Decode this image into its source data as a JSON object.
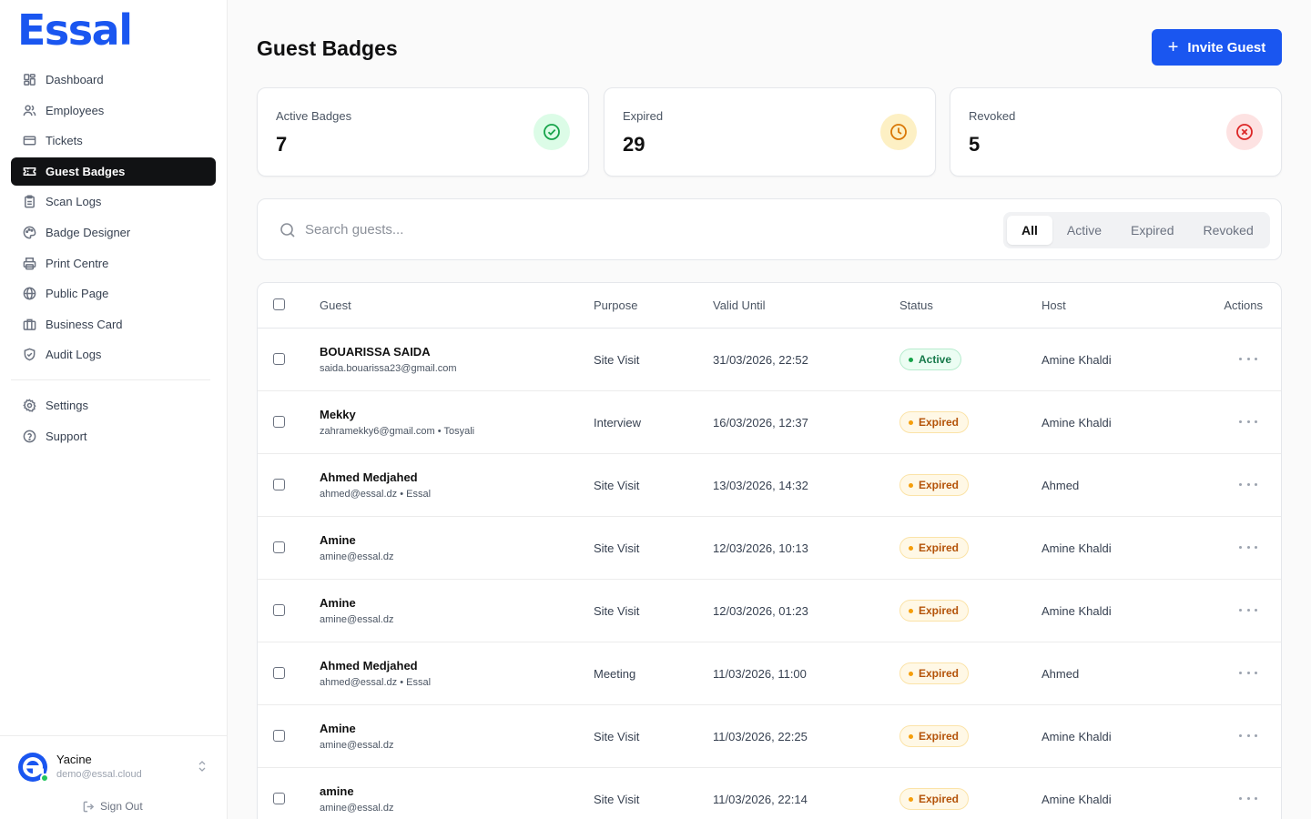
{
  "brand": {
    "name": "Essal",
    "color": "#1a56f0"
  },
  "sidebar": {
    "items": [
      {
        "label": "Dashboard",
        "icon": "dashboard-icon"
      },
      {
        "label": "Employees",
        "icon": "users-icon"
      },
      {
        "label": "Tickets",
        "icon": "ticket-icon"
      },
      {
        "label": "Guest Badges",
        "icon": "badge-icon",
        "active": true
      },
      {
        "label": "Scan Logs",
        "icon": "clipboard-icon"
      },
      {
        "label": "Badge Designer",
        "icon": "palette-icon"
      },
      {
        "label": "Print Centre",
        "icon": "printer-icon"
      },
      {
        "label": "Public Page",
        "icon": "globe-icon"
      },
      {
        "label": "Business Card",
        "icon": "briefcase-icon"
      },
      {
        "label": "Audit Logs",
        "icon": "shield-icon"
      }
    ],
    "secondary": [
      {
        "label": "Settings",
        "icon": "gear-icon"
      },
      {
        "label": "Support",
        "icon": "help-circle-icon"
      }
    ],
    "user": {
      "name": "Yacine",
      "email": "demo@essal.cloud",
      "status": "online"
    },
    "sign_out": "Sign Out"
  },
  "header": {
    "title": "Guest Badges",
    "invite_label": "Invite Guest"
  },
  "stats": [
    {
      "label": "Active Badges",
      "value": "7",
      "icon": "check-circle-icon",
      "color": "#16a34a",
      "bg": "#dcfce7"
    },
    {
      "label": "Expired",
      "value": "29",
      "icon": "clock-icon",
      "color": "#d97706",
      "bg": "#fdf0c4"
    },
    {
      "label": "Revoked",
      "value": "5",
      "icon": "x-circle-icon",
      "color": "#dc2626",
      "bg": "#fde2e2"
    }
  ],
  "search": {
    "placeholder": "Search guests..."
  },
  "filters": {
    "options": [
      "All",
      "Active",
      "Expired",
      "Revoked"
    ],
    "selected": "All"
  },
  "table": {
    "columns": [
      "Guest",
      "Purpose",
      "Valid Until",
      "Status",
      "Host",
      "Actions"
    ],
    "rows": [
      {
        "name": "BOUARISSA SAIDA",
        "sub": "saida.bouarissa23@gmail.com",
        "purpose": "Site Visit",
        "valid_until": "31/03/2026, 22:52",
        "status": "Active",
        "host": "Amine Khaldi"
      },
      {
        "name": "Mekky",
        "sub": "zahramekky6@gmail.com • Tosyali",
        "purpose": "Interview",
        "valid_until": "16/03/2026, 12:37",
        "status": "Expired",
        "host": "Amine Khaldi"
      },
      {
        "name": "Ahmed Medjahed",
        "sub": "ahmed@essal.dz • Essal",
        "purpose": "Site Visit",
        "valid_until": "13/03/2026, 14:32",
        "status": "Expired",
        "host": "Ahmed"
      },
      {
        "name": "Amine",
        "sub": "amine@essal.dz",
        "purpose": "Site Visit",
        "valid_until": "12/03/2026, 10:13",
        "status": "Expired",
        "host": "Amine Khaldi"
      },
      {
        "name": "Amine",
        "sub": "amine@essal.dz",
        "purpose": "Site Visit",
        "valid_until": "12/03/2026, 01:23",
        "status": "Expired",
        "host": "Amine Khaldi"
      },
      {
        "name": "Ahmed Medjahed",
        "sub": "ahmed@essal.dz • Essal",
        "purpose": "Meeting",
        "valid_until": "11/03/2026, 11:00",
        "status": "Expired",
        "host": "Ahmed"
      },
      {
        "name": "Amine",
        "sub": "amine@essal.dz",
        "purpose": "Site Visit",
        "valid_until": "11/03/2026, 22:25",
        "status": "Expired",
        "host": "Amine Khaldi"
      },
      {
        "name": "amine",
        "sub": "amine@essal.dz",
        "purpose": "Site Visit",
        "valid_until": "11/03/2026, 22:14",
        "status": "Expired",
        "host": "Amine Khaldi"
      }
    ]
  }
}
